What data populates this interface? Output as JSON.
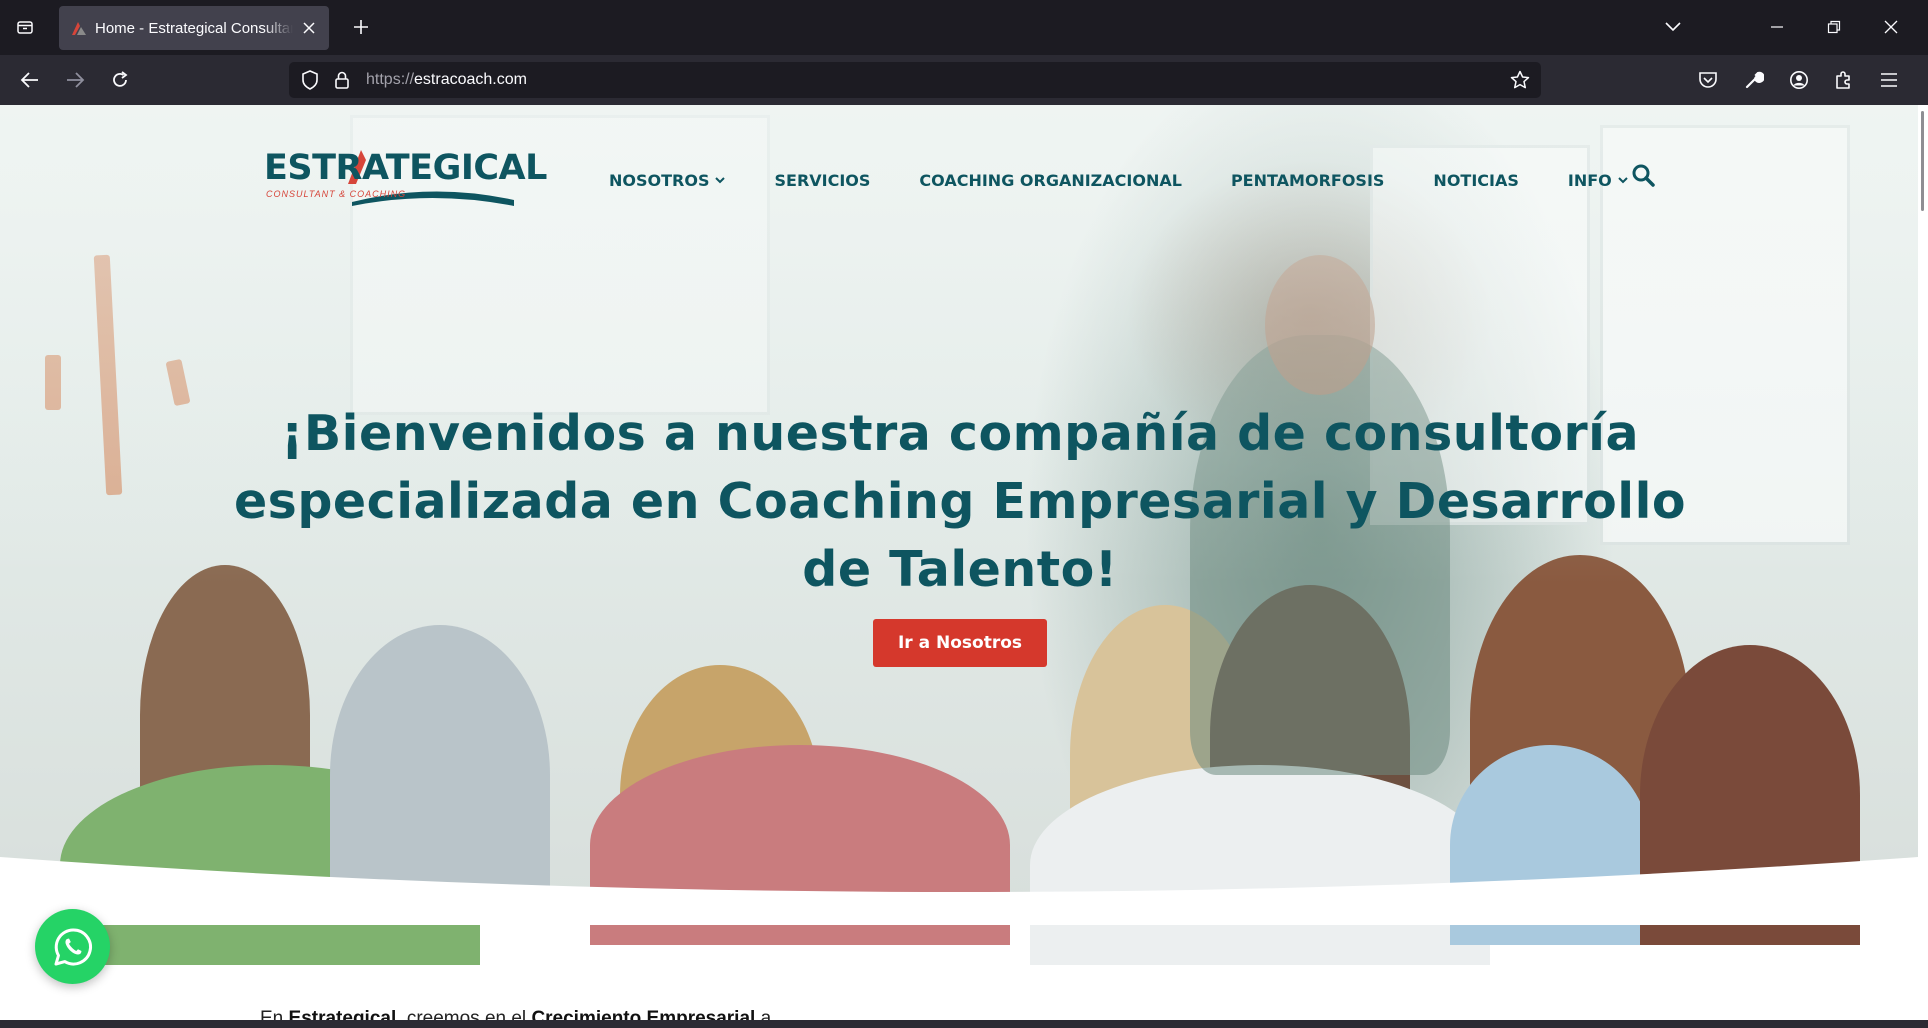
{
  "browser": {
    "tab_title": "Home - Estrategical Consultant",
    "url_scheme": "https://",
    "url_host": "estracoach.com",
    "icons": [
      "tab-list-icon",
      "close-icon",
      "plus-icon",
      "chevron-down-icon",
      "minimize-icon",
      "restore-icon",
      "window-close-icon",
      "back-arrow-icon",
      "forward-arrow-icon",
      "reload-icon",
      "shield-icon",
      "lock-icon",
      "star-icon",
      "pocket-icon",
      "wrench-icon",
      "account-icon",
      "extensions-icon",
      "hamburger-menu-icon"
    ]
  },
  "site": {
    "logo_text": "ESTRATEGICAL",
    "logo_subtext": "CONSULTANT & COACHING",
    "menu": [
      {
        "label": "NOSOTROS",
        "has_dropdown": true
      },
      {
        "label": "SERVICIOS",
        "has_dropdown": false
      },
      {
        "label": "COACHING ORGANIZACIONAL",
        "has_dropdown": false
      },
      {
        "label": "PENTAMORFOSIS",
        "has_dropdown": false
      },
      {
        "label": "NOTICIAS",
        "has_dropdown": false
      },
      {
        "label": "INFO",
        "has_dropdown": true
      }
    ],
    "hero": {
      "headline_line1": "¡Bienvenidos a nuestra compañía de consultoría",
      "headline_line2": "especializada en Coaching Empresarial y Desarrollo",
      "headline_line3": "de Talento!",
      "cta_label": "Ir a Nosotros"
    },
    "intro": {
      "prefix": "En ",
      "brand": "Estrategical",
      "middle": ", creemos en el ",
      "emphasis": "Crecimiento Empresarial",
      "suffix": " a"
    },
    "colors": {
      "brand_teal": "#0e5560",
      "cta_red": "#d5382c",
      "whatsapp_green": "#25d366"
    }
  }
}
